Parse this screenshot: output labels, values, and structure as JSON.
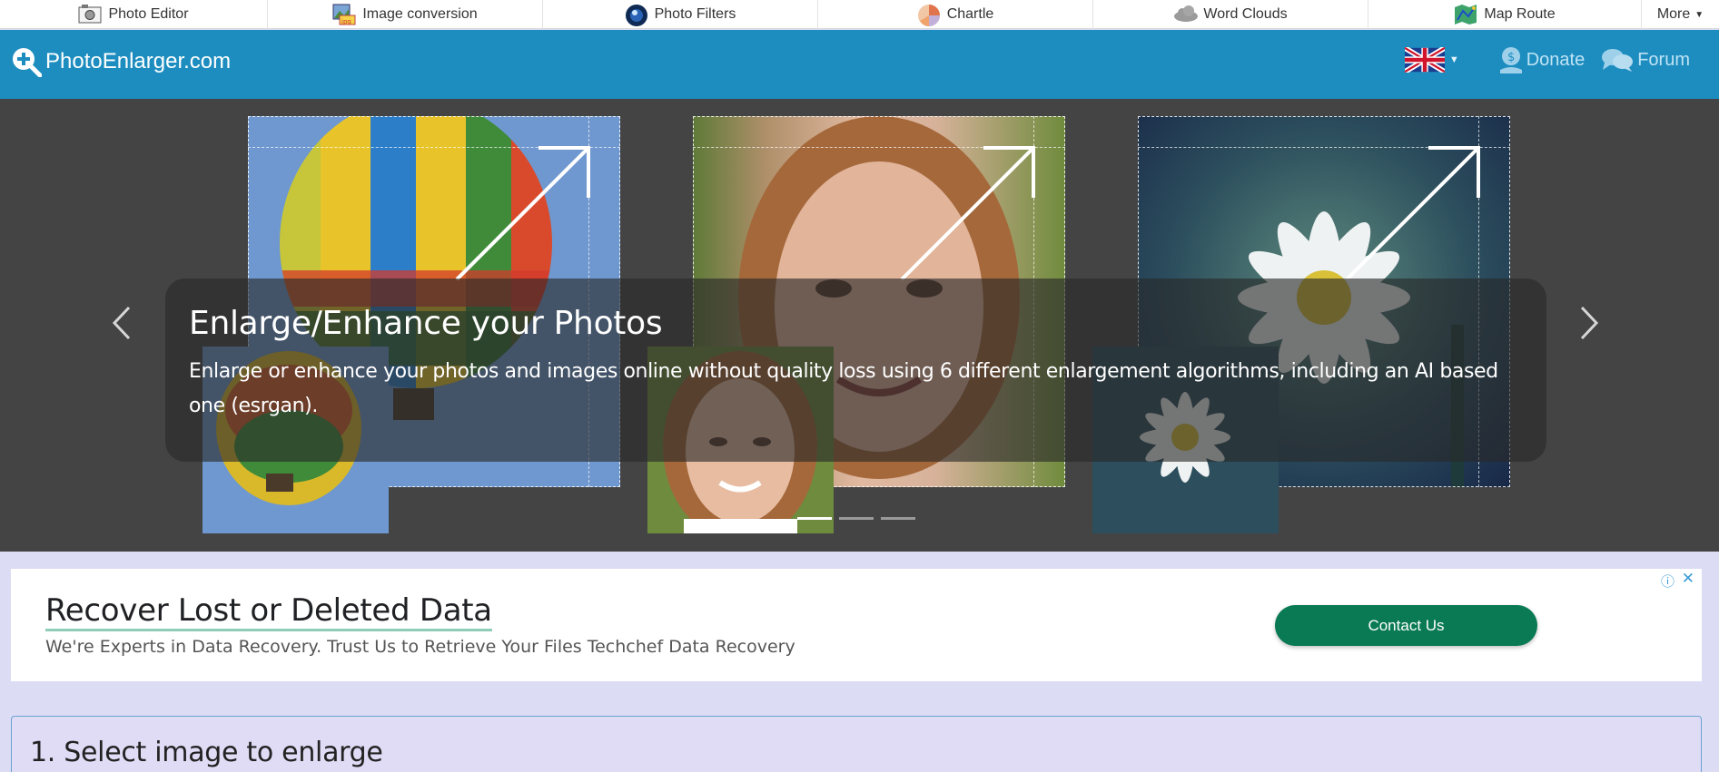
{
  "topnav": {
    "items": [
      {
        "label": "Photo Editor",
        "icon": "photo-editor-icon"
      },
      {
        "label": "Image conversion",
        "icon": "image-conversion-icon"
      },
      {
        "label": "Photo Filters",
        "icon": "photo-filters-icon"
      },
      {
        "label": "Chartle",
        "icon": "chartle-icon"
      },
      {
        "label": "Word Clouds",
        "icon": "word-clouds-icon"
      },
      {
        "label": "Map Route",
        "icon": "map-route-icon"
      }
    ],
    "more_label": "More"
  },
  "header": {
    "site_name": "PhotoEnlarger.com",
    "donate_label": "Donate",
    "forum_label": "Forum",
    "language_flag": "uk-flag-icon",
    "background_color": "#1d8dc0"
  },
  "carousel": {
    "title": "Enlarge/Enhance your Photos",
    "description": "Enlarge or enhance your photos and images online without quality loss using 6 different enlargement algorithms, including an AI based one (esrgan).",
    "slide_count": 3,
    "active_slide": 1,
    "prev_icon": "chevron-left-icon",
    "next_icon": "chevron-right-icon"
  },
  "ad": {
    "title": "Recover Lost or Deleted Data",
    "description": "We're Experts in Data Recovery. Trust Us to Retrieve Your Files Techchef Data Recovery",
    "button_label": "Contact Us",
    "button_color": "#0a7a55"
  },
  "step": {
    "title": "1. Select image to enlarge"
  }
}
